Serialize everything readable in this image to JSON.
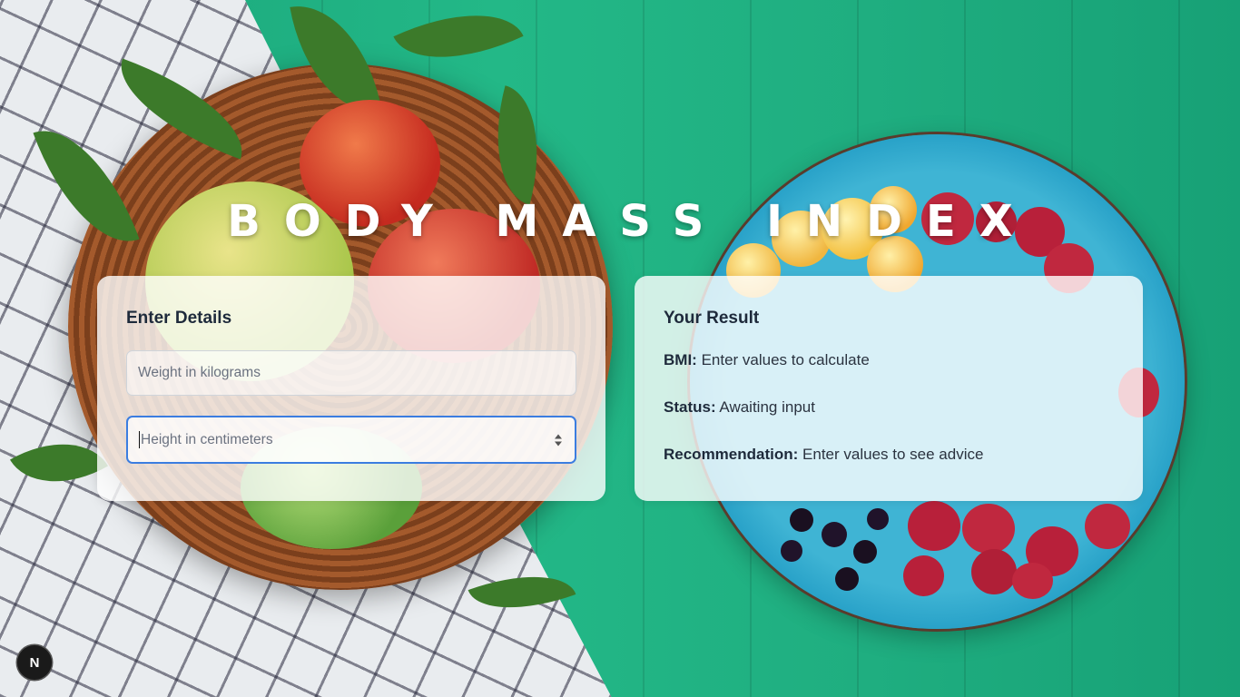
{
  "title": "BODY MASS INDEX",
  "details": {
    "heading": "Enter Details",
    "weight_placeholder": "Weight in kilograms",
    "height_placeholder": "Height in centimeters"
  },
  "result": {
    "heading": "Your Result",
    "bmi_label": "BMI:",
    "bmi_value": "Enter values to calculate",
    "status_label": "Status:",
    "status_value": "Awaiting input",
    "recommendation_label": "Recommendation:",
    "recommendation_value": "Enter values to see advice"
  },
  "badge": {
    "letter": "N"
  },
  "colors": {
    "accent": "#3b7de0",
    "heading": "#1e2a3b",
    "background": "#1fae7e"
  }
}
